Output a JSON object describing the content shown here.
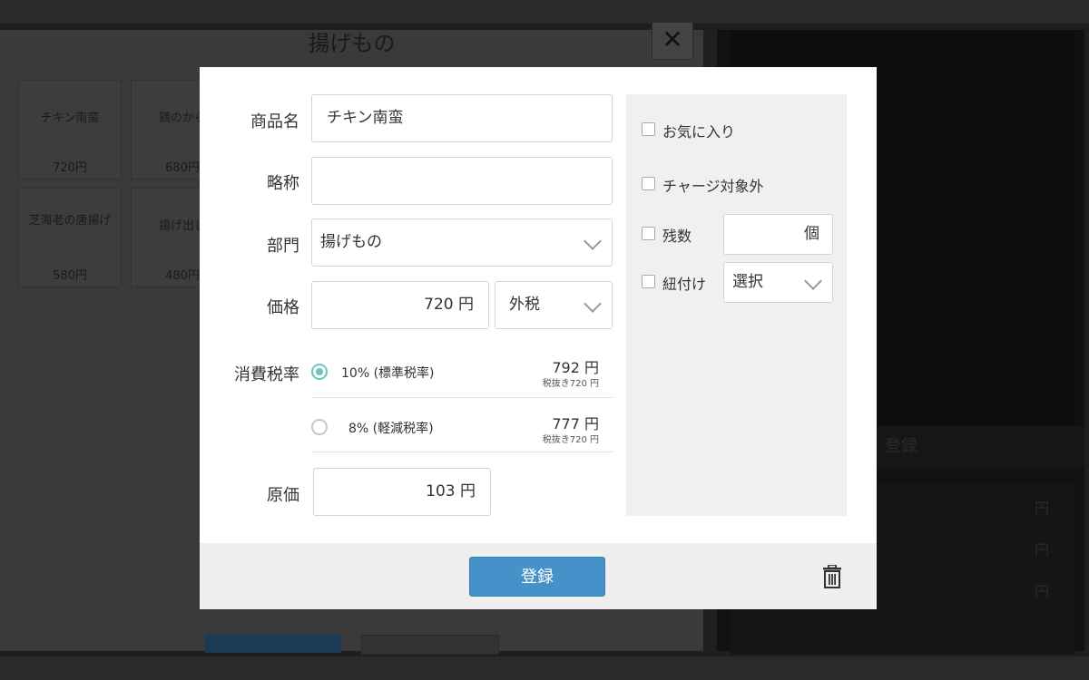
{
  "background": {
    "title": "揚げもの",
    "close_glyph": "✕",
    "tiles": [
      {
        "name": "チキン南蛮",
        "price": "720円"
      },
      {
        "name": "鶏のから",
        "price": "680円"
      },
      {
        "name": "芝海老の唐揚げ",
        "price": "580円"
      },
      {
        "name": "揚げ出し",
        "price": "480円"
      }
    ],
    "right_button": "登録",
    "yen": [
      "円",
      "円",
      "円"
    ]
  },
  "form": {
    "product_name_label": "商品名",
    "product_name_value": "チキン南蛮",
    "short_name_label": "略称",
    "short_name_value": "",
    "department_label": "部門",
    "department_value": "揚げもの",
    "price_label": "価格",
    "price_value": "720 円",
    "tax_mode_value": "外税",
    "tax_rate_label": "消費税率",
    "tax_rates": [
      {
        "label": "10% (標準税率)",
        "price": "792 円",
        "sub": "税抜き720 円",
        "selected": true
      },
      {
        "label": "8% (軽減税率)",
        "price": "777 円",
        "sub": "税抜き720 円",
        "selected": false
      }
    ],
    "cost_label": "原価",
    "cost_value": "103 円"
  },
  "side": {
    "favorite_label": "お気に入り",
    "no_charge_label": "チャージ対象外",
    "stock_label": "残数",
    "stock_unit": "個",
    "link_label": "紐付け",
    "link_select_value": "選択"
  },
  "footer": {
    "register_label": "登録"
  },
  "colors": {
    "accent": "#4492c9",
    "radio_selected": "#6fc5bb"
  }
}
